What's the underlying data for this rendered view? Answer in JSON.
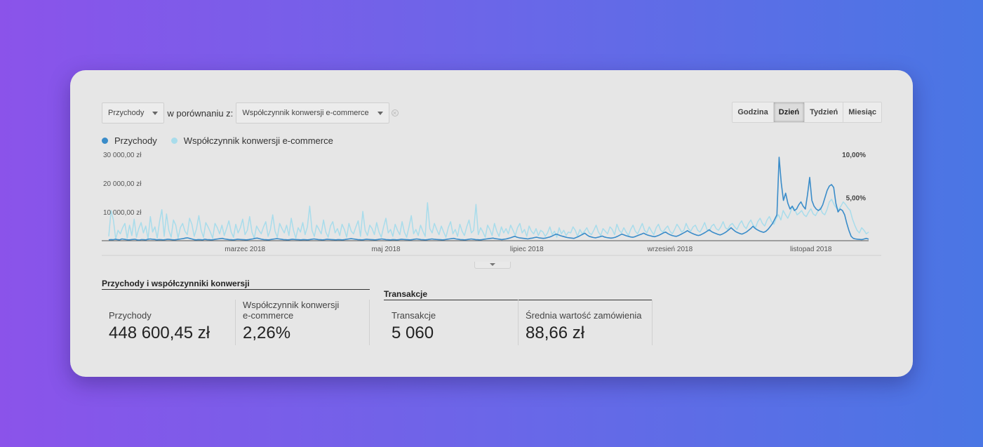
{
  "toolbar": {
    "metric1": "Przychody",
    "compare_label": "w porównaniu z:",
    "metric2": "Współczynnik konwersji e-commerce"
  },
  "periods": [
    "Godzina",
    "Dzień",
    "Tydzień",
    "Miesiąc"
  ],
  "active_period": "Dzień",
  "colors": {
    "primary": "#3a8cc9",
    "secondary": "#a8dceb"
  },
  "chart_data": {
    "type": "line",
    "title": "",
    "x_ticks": [
      "marzec 2018",
      "maj 2018",
      "lipiec 2018",
      "wrzesień 2018",
      "listopad 2018"
    ],
    "left_axis": {
      "ticks": [
        "30 000,00 zł",
        "20 000,00 zł",
        "10 000,00 zł"
      ],
      "ylim": [
        0,
        30000
      ]
    },
    "right_axis": {
      "ticks": [
        "10,00%",
        "5,00%"
      ],
      "ylim": [
        0,
        10
      ]
    },
    "series": [
      {
        "name": "Przychody",
        "axis": "left",
        "color": "#3a8cc9",
        "values": [
          300,
          400,
          350,
          500,
          400,
          300,
          600,
          500,
          400,
          300,
          350,
          450,
          500,
          300,
          250,
          400,
          350,
          300,
          500,
          600,
          500,
          450,
          300,
          400,
          350,
          300,
          400,
          500,
          450,
          350,
          300,
          400,
          500,
          600,
          700,
          900,
          1000,
          800,
          600,
          400,
          300,
          400,
          350,
          300,
          500,
          400,
          350,
          300,
          400,
          500,
          600,
          700,
          800,
          600,
          500,
          400,
          350,
          300,
          400,
          500,
          450,
          400,
          350,
          300,
          400,
          500,
          600,
          800,
          900,
          700,
          500,
          400,
          350,
          300,
          400,
          500,
          600,
          700,
          600,
          500,
          400,
          350,
          300,
          400,
          500,
          450,
          400,
          350,
          300,
          400,
          350,
          300,
          400,
          500,
          600,
          500,
          400,
          350,
          300,
          400,
          500,
          450,
          400,
          350,
          300,
          400,
          350,
          300,
          400,
          500,
          600,
          700,
          600,
          500,
          400,
          350,
          300,
          400,
          500,
          450,
          400,
          350,
          300,
          400,
          500,
          600,
          500,
          400,
          350,
          300,
          400,
          350,
          300,
          400,
          500,
          450,
          400,
          350,
          300,
          400,
          500,
          600,
          500,
          400,
          350,
          300,
          400,
          500,
          600,
          500,
          450,
          400,
          350,
          300,
          400,
          500,
          600,
          700,
          800,
          600,
          500,
          400,
          350,
          300,
          400,
          500,
          600,
          500,
          400,
          350,
          300,
          400,
          500,
          600,
          700,
          800,
          900,
          700,
          600,
          500,
          400,
          500,
          600,
          800,
          1000,
          1300,
          1500,
          1200,
          1000,
          900,
          800,
          700,
          600,
          800,
          900,
          1100,
          1200,
          1000,
          900,
          800,
          900,
          1100,
          1300,
          1600,
          2000,
          2300,
          2000,
          1700,
          1500,
          1300,
          1100,
          1000,
          900,
          800,
          1100,
          1400,
          1800,
          2200,
          2600,
          2000,
          1500,
          1300,
          1100,
          1000,
          1200,
          1400,
          1600,
          1300,
          1100,
          1000,
          900,
          1000,
          1200,
          1500,
          1900,
          2300,
          2000,
          1700,
          1500,
          1300,
          1200,
          1400,
          1700,
          2000,
          2300,
          2600,
          2200,
          1900,
          1700,
          1500,
          1400,
          1600,
          1900,
          2300,
          2700,
          3000,
          2500,
          2100,
          1800,
          1600,
          1500,
          1800,
          2200,
          2600,
          3000,
          3500,
          3000,
          2600,
          2300,
          2000,
          1800,
          2000,
          2400,
          2800,
          3300,
          3800,
          3200,
          2800,
          2500,
          2200,
          2000,
          2300,
          2700,
          3200,
          3800,
          4500,
          3800,
          3200,
          2800,
          2500,
          2300,
          2600,
          3000,
          3600,
          4200,
          5000,
          4300,
          3800,
          3400,
          3100,
          2900,
          3300,
          4000,
          5000,
          6000,
          7500,
          9000,
          29000,
          20000,
          14000,
          16500,
          13000,
          11000,
          12000,
          10500,
          11000,
          12500,
          13500,
          12000,
          11000,
          16000,
          22000,
          14000,
          12000,
          11000,
          10500,
          11000,
          12500,
          15000,
          17500,
          19000,
          19500,
          18500,
          13000,
          10000,
          11000,
          10500,
          9000,
          6000,
          3500,
          1500,
          800,
          600,
          500,
          450,
          400,
          600,
          800,
          500
        ],
        "note_first_day": "2018-01-01"
      },
      {
        "name": "Współczynnik konwersji e-commerce",
        "axis": "right",
        "color": "#a8dceb",
        "values": [
          0.5,
          3.5,
          2.4,
          0.2,
          1.2,
          0.8,
          1.5,
          2.0,
          0.3,
          1.8,
          0.6,
          2.5,
          0.4,
          1.4,
          2.1,
          0.9,
          1.7,
          0.2,
          2.8,
          1.0,
          1.6,
          0.3,
          2.2,
          3.6,
          0.5,
          3.1,
          1.2,
          0.4,
          2.4,
          1.8,
          0.3,
          1.5,
          2.0,
          1.1,
          0.7,
          2.6,
          1.9,
          0.5,
          1.4,
          2.9,
          1.2,
          0.4,
          2.1,
          1.6,
          1.0,
          0.3,
          2.0,
          1.5,
          0.8,
          1.8,
          0.6,
          1.4,
          2.3,
          1.0,
          0.4,
          1.9,
          0.9,
          1.5,
          2.5,
          0.7,
          1.2,
          2.8,
          1.0,
          0.3,
          1.7,
          1.2,
          0.8,
          1.6,
          2.2,
          0.5,
          1.3,
          3.0,
          1.1,
          0.4,
          2.0,
          1.4,
          0.9,
          1.8,
          0.6,
          2.6,
          1.2,
          0.3,
          1.5,
          1.0,
          2.1,
          0.7,
          1.6,
          4.0,
          1.2,
          0.5,
          1.8,
          1.3,
          0.8,
          2.4,
          1.0,
          0.4,
          1.7,
          2.2,
          0.9,
          1.4,
          0.6,
          1.9,
          1.3,
          0.4,
          2.0,
          1.1,
          0.8,
          1.6,
          2.3,
          0.5,
          3.4,
          1.2,
          0.6,
          1.8,
          1.4,
          0.7,
          2.1,
          1.0,
          0.4,
          1.6,
          2.6,
          0.9,
          1.3,
          0.5,
          1.9,
          1.2,
          0.7,
          2.2,
          1.0,
          0.4,
          1.6,
          2.9,
          0.8,
          1.3,
          0.6,
          1.8,
          1.1,
          0.5,
          4.4,
          1.4,
          0.9,
          2.0,
          1.3,
          0.7,
          1.7,
          1.0,
          0.4,
          1.5,
          2.2,
          0.8,
          1.3,
          0.5,
          1.9,
          1.1,
          0.6,
          1.6,
          2.4,
          0.9,
          1.2,
          4.2,
          0.7,
          1.5,
          1.0,
          0.4,
          1.8,
          1.3,
          0.6,
          2.0,
          1.1,
          0.5,
          1.6,
          0.9,
          1.4,
          0.8,
          1.8,
          1.2,
          0.6,
          1.5,
          2.0,
          0.9,
          1.3,
          0.5,
          1.7,
          1.1,
          0.8,
          1.4,
          0.6,
          1.2,
          1.0,
          0.5,
          0.9,
          1.6,
          0.7,
          1.1,
          0.4,
          1.5,
          0.8,
          1.2,
          0.6,
          1.0,
          0.9,
          1.6,
          1.2,
          0.5,
          1.3,
          0.8,
          1.1,
          1.5,
          0.9,
          0.7,
          1.2,
          1.8,
          1.0,
          0.6,
          1.4,
          1.1,
          0.8,
          1.6,
          1.3,
          0.7,
          1.9,
          1.2,
          0.9,
          1.5,
          1.0,
          0.6,
          1.3,
          1.8,
          1.1,
          0.8,
          1.4,
          2.0,
          1.2,
          0.9,
          1.6,
          1.1,
          0.7,
          1.5,
          1.9,
          1.2,
          1.0,
          1.4,
          1.7,
          1.1,
          0.8,
          1.3,
          1.9,
          1.5,
          1.0,
          1.2,
          2.0,
          1.4,
          1.1,
          1.6,
          1.8,
          1.2,
          1.0,
          1.5,
          2.1,
          1.3,
          1.1,
          1.7,
          1.9,
          1.4,
          1.2,
          1.6,
          2.2,
          1.5,
          1.3,
          1.8,
          2.0,
          1.6,
          1.3,
          1.9,
          2.3,
          1.7,
          1.4,
          2.0,
          2.4,
          1.8,
          1.5,
          2.2,
          2.6,
          2.0,
          1.7,
          2.4,
          2.8,
          2.2,
          1.9,
          2.6,
          3.0,
          2.4,
          3.5,
          3.0,
          2.6,
          3.2,
          4.0,
          3.6,
          3.0,
          3.2,
          3.5,
          3.0,
          2.8,
          3.3,
          3.7,
          3.1,
          2.9,
          3.4,
          3.8,
          3.2,
          3.0,
          3.6,
          4.5,
          4.8,
          4.2,
          3.8,
          3.6,
          4.0,
          4.5,
          4.2,
          3.8,
          3.5,
          2.5,
          1.8,
          1.2,
          0.9,
          1.5,
          1.2,
          0.8,
          1.0
        ]
      }
    ]
  },
  "section1": {
    "title": "Przychody i współczynniki konwersji",
    "metrics": [
      {
        "label": "Przychody",
        "value": "448 600,45 zł"
      },
      {
        "label": "Współczynnik konwersji e-commerce",
        "value": "2,26%"
      }
    ]
  },
  "section2": {
    "title": "Transakcje",
    "metrics": [
      {
        "label": "Transakcje",
        "value": "5 060"
      },
      {
        "label": "Średnia wartość zamówienia",
        "value": "88,66 zł"
      }
    ]
  }
}
